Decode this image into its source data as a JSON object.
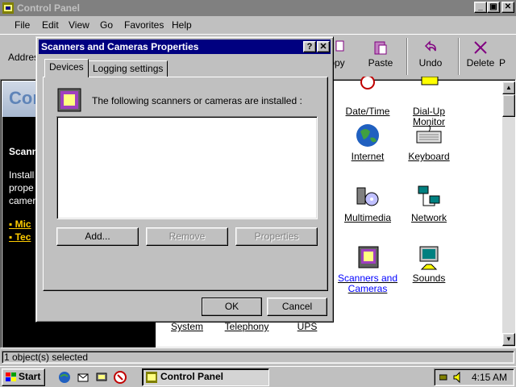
{
  "window": {
    "title": "Control Panel",
    "caption_minimize": "_",
    "caption_maximize": "▣",
    "caption_close": "✕"
  },
  "menu": {
    "items": [
      "File",
      "Edit",
      "View",
      "Go",
      "Favorites",
      "Help"
    ]
  },
  "toolbar": {
    "address_label": "Addres",
    "copy_label": "opy",
    "paste_label": "Paste",
    "undo_label": "Undo",
    "delete_label": "Delete",
    "properties_label": "P"
  },
  "left_pane": {
    "title": "Cont",
    "selected_name": "Scann",
    "description": "Install\nprope\ncamer",
    "link1": "Mic",
    "link2": "Tec"
  },
  "icons": [
    {
      "label": "Date/Time",
      "icon": "date-time-icon"
    },
    {
      "label": "Dial-Up Monitor",
      "icon": "dialup-monitor-icon"
    },
    {
      "label": "Internet",
      "icon": "internet-globe-icon"
    },
    {
      "label": "Keyboard",
      "icon": "keyboard-icon"
    },
    {
      "label": "Multimedia",
      "icon": "multimedia-icon"
    },
    {
      "label": "Network",
      "icon": "network-icon"
    },
    {
      "label": "Scanners and Cameras",
      "icon": "scanner-camera-icon"
    },
    {
      "label": "Sounds",
      "icon": "sounds-icon"
    },
    {
      "label": "System",
      "icon": "system-icon"
    },
    {
      "label": "Telephony",
      "icon": "telephony-icon"
    },
    {
      "label": "UPS",
      "icon": "ups-icon"
    }
  ],
  "status_bar": {
    "text": "1 object(s) selected"
  },
  "taskbar": {
    "start_label": "Start",
    "task_label": "Control Panel",
    "clock": "4:15 AM"
  },
  "dialog": {
    "title": "Scanners and Cameras Properties",
    "help_btn": "?",
    "close_btn": "✕",
    "tabs": [
      "Devices",
      "Logging settings"
    ],
    "installed_text": "The following scanners or cameras are installed :",
    "add_label": "Add...",
    "remove_label": "Remove",
    "properties_label": "Properties",
    "ok_label": "OK",
    "cancel_label": "Cancel"
  },
  "colors": {
    "dialog_title_bg": "#000080",
    "inactive_title_bg": "#808080",
    "face": "#c0c0c0",
    "left_pane_bg": "#000000",
    "link_color": "#ffcc00"
  }
}
